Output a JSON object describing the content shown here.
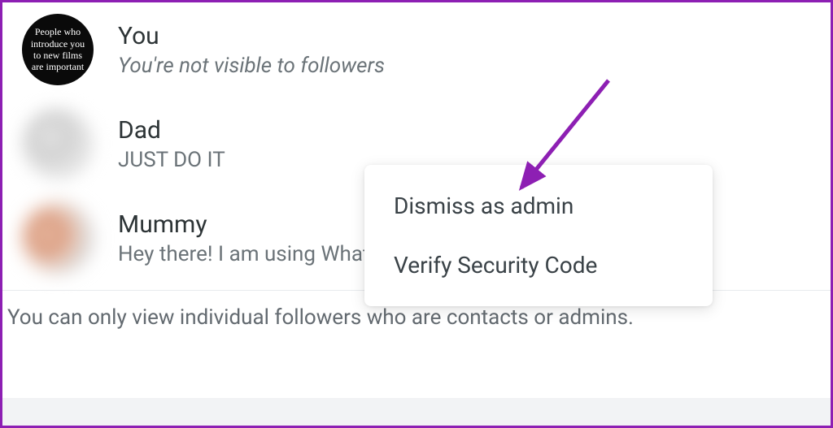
{
  "followers": [
    {
      "name": "You",
      "subtitle": "You're not visible to followers",
      "avatar_text": "People who introduce you to new films are important"
    },
    {
      "name": "Dad",
      "subtitle": "JUST DO IT"
    },
    {
      "name": "Mummy",
      "subtitle": "Hey there! I am using What"
    }
  ],
  "note": "You can only view individual followers who are contacts or admins.",
  "context_menu": {
    "items": [
      "Dismiss as admin",
      "Verify Security Code"
    ]
  },
  "annotation": {
    "arrow_color": "#8d1fb3"
  }
}
